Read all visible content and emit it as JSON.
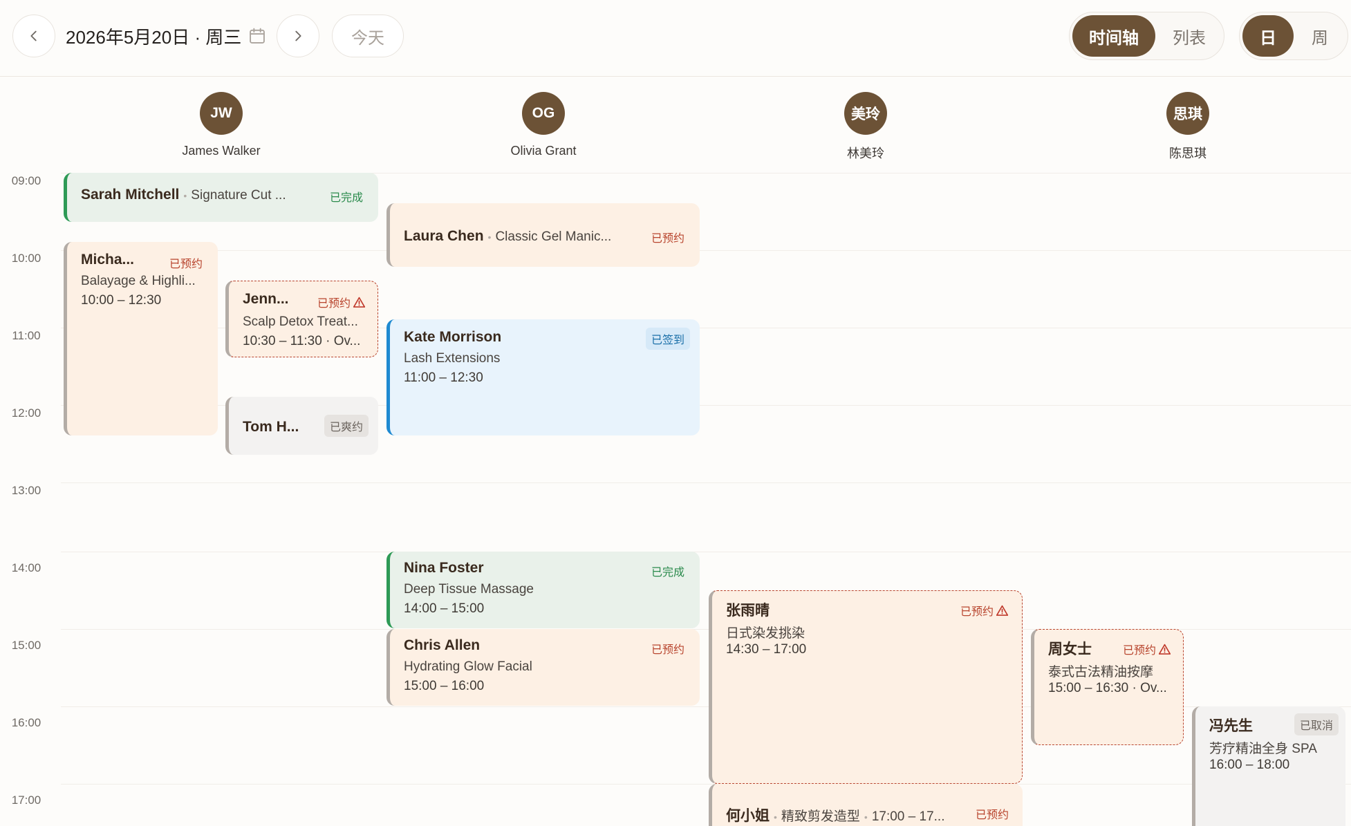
{
  "header": {
    "date_title": "2026年5月20日 · 周三",
    "today_label": "今天",
    "view_mode": [
      "时间轴",
      "列表"
    ],
    "active_view_mode": "时间轴",
    "range_mode": [
      "日",
      "周"
    ],
    "active_range_mode": "日"
  },
  "staff": [
    {
      "initials": "JW",
      "name": "James Walker"
    },
    {
      "initials": "OG",
      "name": "Olivia Grant"
    },
    {
      "initials": "美玲",
      "name": "林美玲"
    },
    {
      "initials": "思琪",
      "name": "陈思琪"
    }
  ],
  "hours": [
    "09:00",
    "10:00",
    "11:00",
    "12:00",
    "13:00",
    "14:00",
    "15:00",
    "16:00",
    "17:00"
  ],
  "appointments": {
    "a1": {
      "name": "Sarah Mitchell",
      "service": "Signature Cut ...",
      "status": "已完成"
    },
    "a2": {
      "name": "Micha...",
      "service": "Balayage & Highli...",
      "time": "10:00 – 12:30",
      "status": "已预约"
    },
    "a3": {
      "name": "Jenn...",
      "service": "Scalp Detox Treat...",
      "time": "10:30 – 11:30 · Ov...",
      "status": "已预约"
    },
    "a4": {
      "name": "Tom H...",
      "status": "已爽约"
    },
    "a5": {
      "name": "Laura Chen",
      "service": "Classic Gel Manic...",
      "status": "已预约"
    },
    "a6": {
      "name": "Kate Morrison",
      "service": "Lash Extensions",
      "time": "11:00 – 12:30",
      "status": "已签到"
    },
    "a7": {
      "name": "Nina Foster",
      "service": "Deep Tissue Massage",
      "time": "14:00 – 15:00",
      "status": "已完成"
    },
    "a8": {
      "name": "Chris Allen",
      "service": "Hydrating Glow Facial",
      "time": "15:00 – 16:00",
      "status": "已预约"
    },
    "a9": {
      "name": "张雨晴",
      "service": "日式染发挑染",
      "time": "14:30 – 17:00",
      "status": "已预约"
    },
    "a10": {
      "name": "何小姐",
      "service": "精致剪发造型",
      "time": "17:00 – 17...",
      "status": "已预约"
    },
    "a11": {
      "name": "周女士",
      "service": "泰式古法精油按摩",
      "time": "15:00 – 16:30 · Ov...",
      "status": "已预约"
    },
    "a12": {
      "name": "冯先生",
      "service": "芳疗精油全身 SPA",
      "time": "16:00 – 18:00",
      "status": "已取消"
    }
  },
  "colors": {
    "brand": "#6c5236",
    "booked_bg": "#fdf0e4",
    "done_bg": "#e9f1ea",
    "done_accent": "#2e9a56",
    "checkin_bg": "#e8f3fc",
    "checkin_accent": "#1f8ad1",
    "warning": "#b9452f"
  }
}
